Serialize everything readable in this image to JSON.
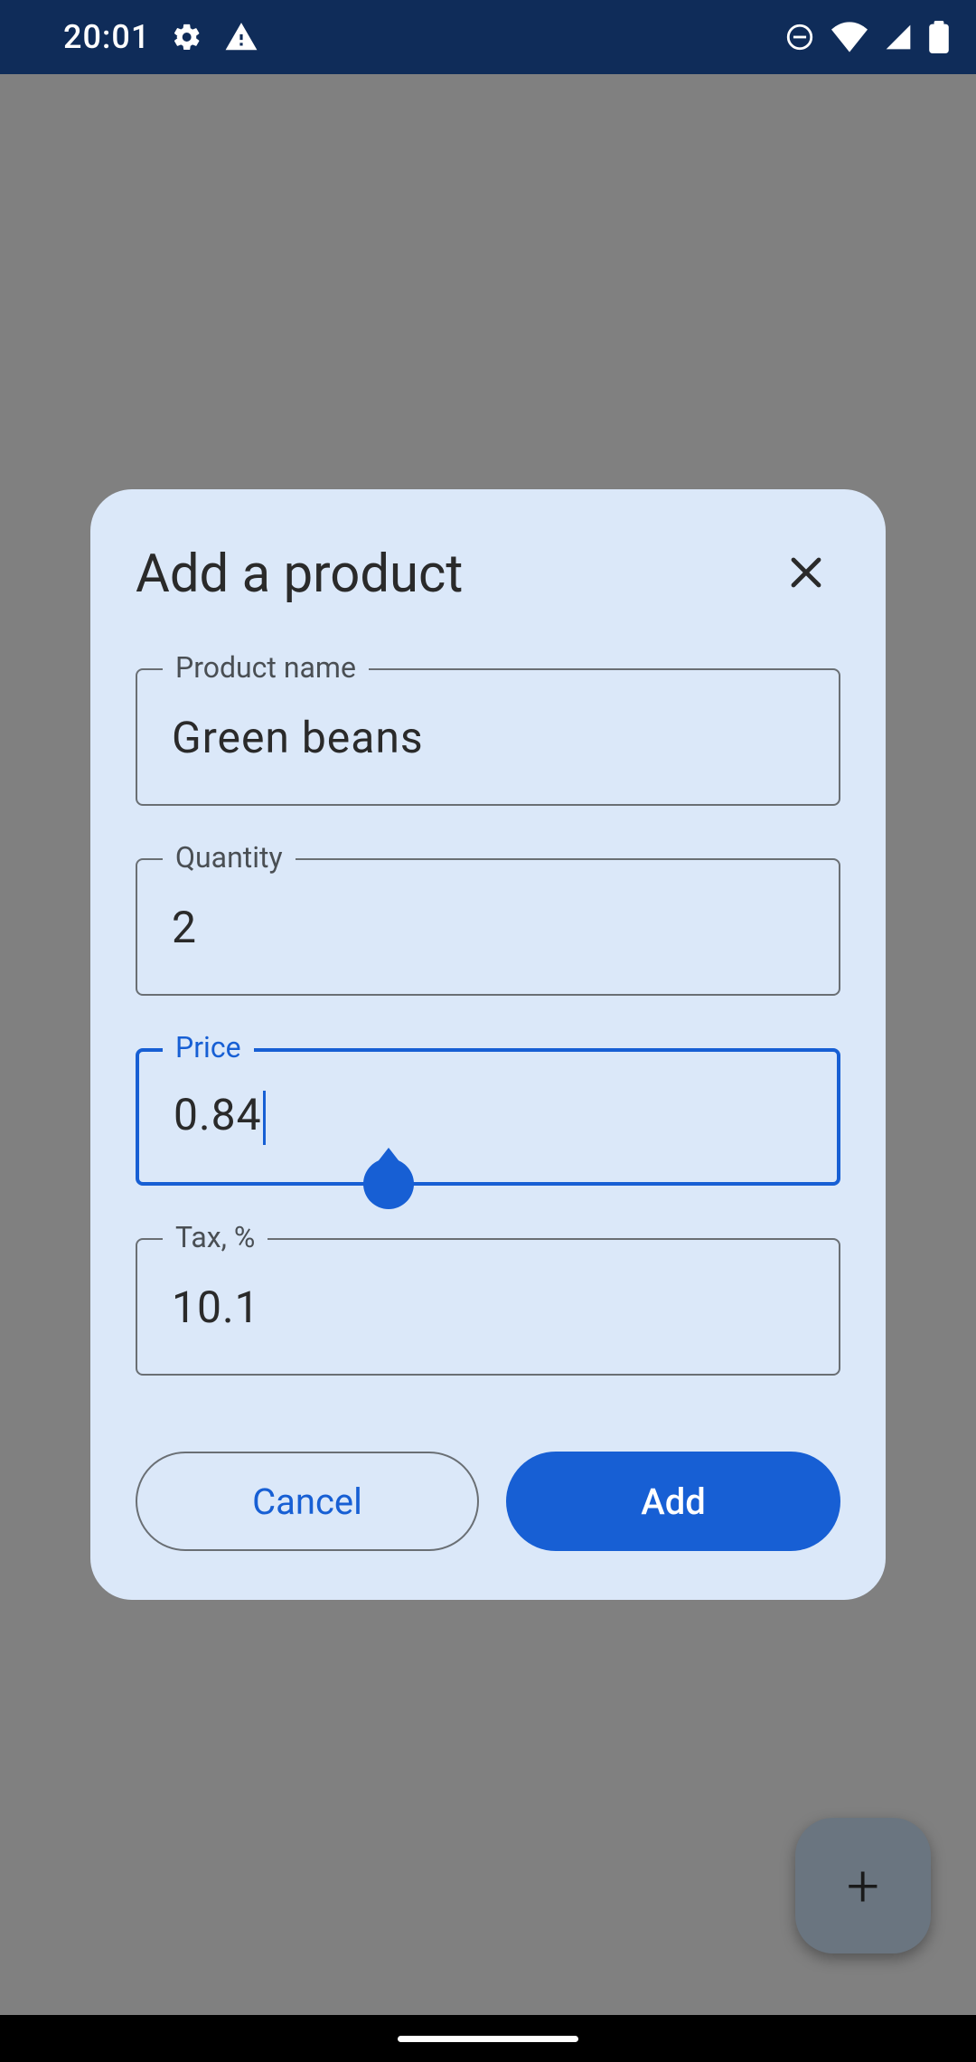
{
  "status": {
    "time": "20:01",
    "icons": {
      "gear": "gear-icon",
      "warning": "warning-icon",
      "dnd": "dnd-icon",
      "wifi": "wifi-icon",
      "signal": "signal-icon",
      "battery": "battery-icon"
    }
  },
  "dialog": {
    "title": "Add a product",
    "fields": {
      "product_name": {
        "label": "Product name",
        "value": "Green beans"
      },
      "quantity": {
        "label": "Quantity",
        "value": "2"
      },
      "price": {
        "label": "Price",
        "value": "0.84"
      },
      "tax": {
        "label": "Tax, %",
        "value": "10.1"
      }
    },
    "actions": {
      "cancel": "Cancel",
      "add": "Add"
    }
  },
  "fab": {
    "glyph": "+"
  },
  "colors": {
    "accent": "#175fd4",
    "dialog_bg": "#dbe8f9",
    "statusbar_bg": "#0f2c59"
  }
}
